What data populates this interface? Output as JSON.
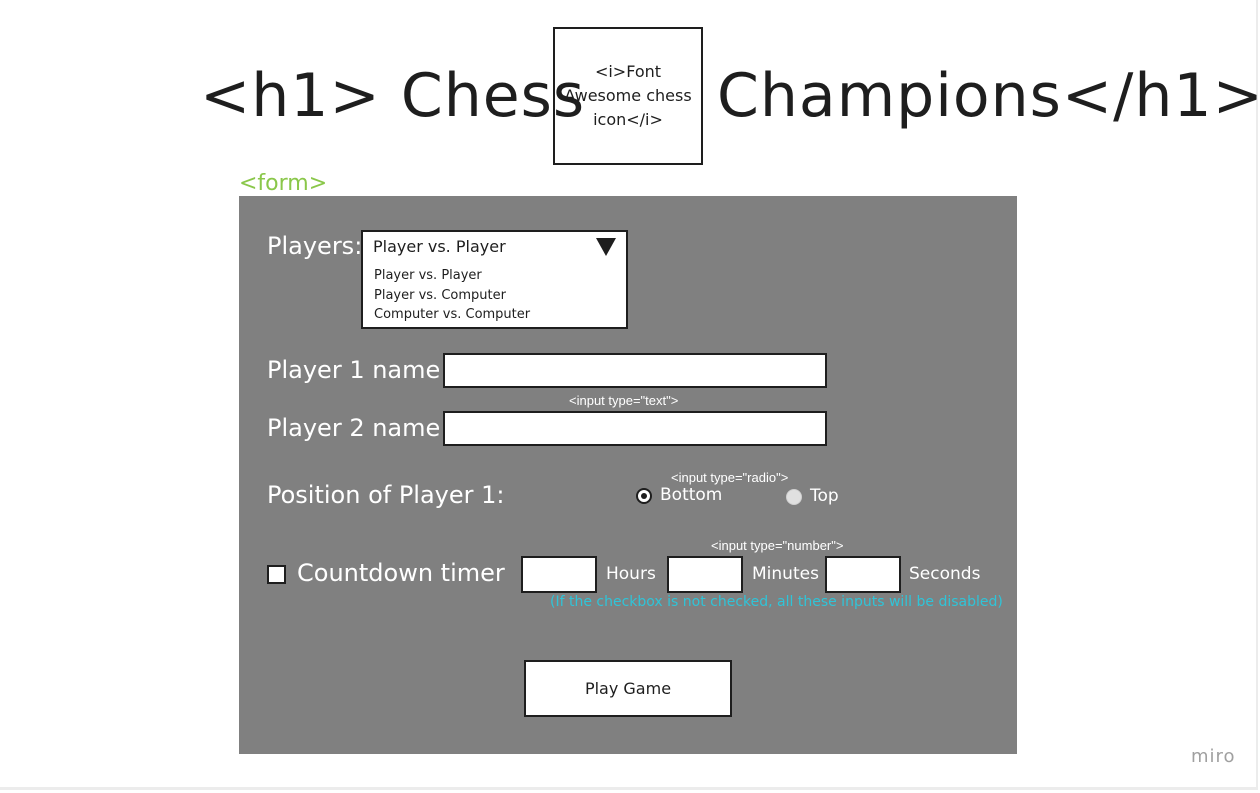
{
  "heading": {
    "left": "<h1> Chess",
    "right": "Champions</h1>",
    "icon_placeholder": "<i>Font Awesome chess icon</i>"
  },
  "form": {
    "tag": "<form>",
    "players": {
      "label": "Players:",
      "selected": "Player vs. Player",
      "options": [
        "Player vs. Player",
        "Player vs. Computer",
        "Computer vs. Computer"
      ]
    },
    "player1": {
      "label": "Player 1 name:",
      "value": ""
    },
    "text_input_note": "<input type=\"text\">",
    "player2": {
      "label": "Player 2 name:",
      "value": ""
    },
    "position": {
      "label": "Position of Player 1:",
      "note": "<input type=\"radio\">",
      "options": [
        {
          "label": "Bottom",
          "checked": true
        },
        {
          "label": "Top",
          "checked": false
        }
      ]
    },
    "timer": {
      "label": "Countdown timer",
      "checked": false,
      "note": "<input type=\"number\">",
      "units": [
        "Hours",
        "Minutes",
        "Seconds"
      ],
      "hint": "(If the checkbox is not checked, all these inputs will be disabled)"
    },
    "play_button": "Play Game"
  },
  "watermark": "miro",
  "colors": {
    "form_background": "#808080",
    "form_tag": "#8ac74a",
    "hint": "#2fc4d8",
    "text_dark": "#1e1e1e"
  }
}
